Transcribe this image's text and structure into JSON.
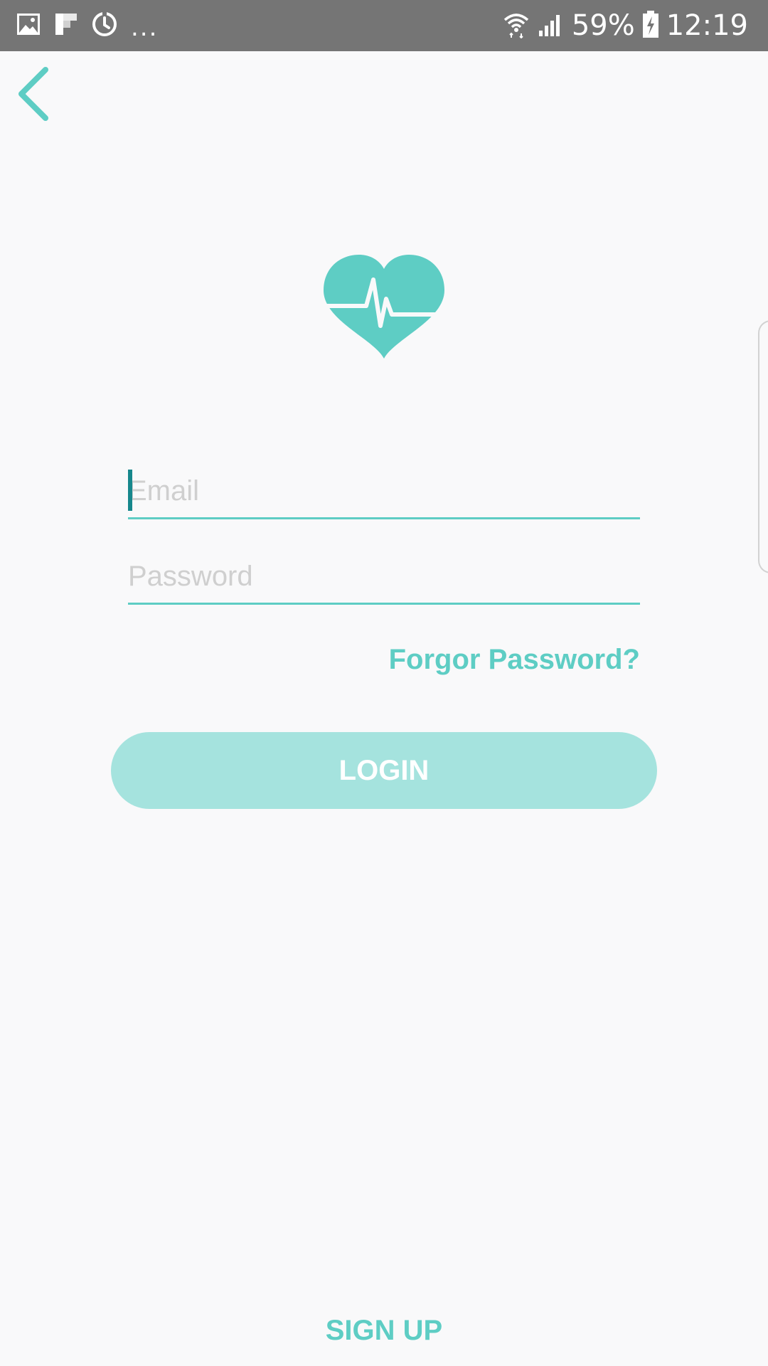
{
  "status_bar": {
    "left_icons": [
      "image-icon",
      "flipboard-icon",
      "sync-icon"
    ],
    "overflow": "...",
    "battery_percent": "59%",
    "time": "12:19",
    "right_icons": [
      "wifi-icon",
      "signal-icon",
      "battery-charging-icon"
    ]
  },
  "nav": {
    "back_icon": "chevron-left-icon"
  },
  "logo": {
    "icon": "heart-pulse-icon"
  },
  "form": {
    "email_placeholder": "Email",
    "password_placeholder": "Password",
    "forgot_label": "Forgor Password?",
    "login_label": "LOGIN"
  },
  "footer": {
    "signup_label": "SIGN UP"
  },
  "colors": {
    "accent": "#5ecdc4",
    "button_disabled": "#a5e3de",
    "caret": "#16878c",
    "status_bar": "#757575",
    "background": "#f9f9fa",
    "placeholder": "#cfcfcf"
  }
}
